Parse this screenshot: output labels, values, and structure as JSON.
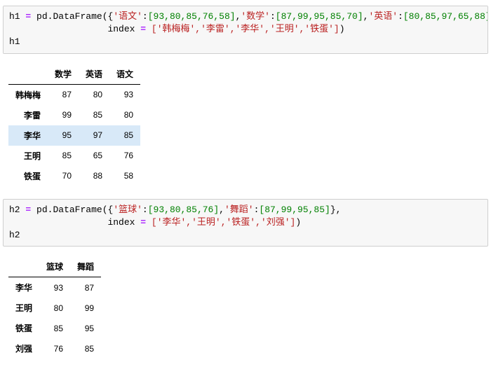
{
  "cell1": {
    "var": "h1",
    "parts": {
      "pd": "pd",
      "dot": ".",
      "df": "DataFrame",
      "openP": "(",
      "openB": "{",
      "k1": "'语文'",
      "colon": ":",
      "v1": "[93,80,85,76,58]",
      "comma": ",",
      "k2": "'数学'",
      "v2": "[87,99,95,85,70]",
      "k3": "'英语'",
      "v3": "[80,85,97,65,88]",
      "closeB": "}",
      "indexKw": "index",
      "eq": "=",
      "idx": "['韩梅梅','李雷','李华','王明','铁蛋']",
      "closeP": ")",
      "line3": "h1"
    }
  },
  "table1": {
    "columns": [
      "数学",
      "英语",
      "语文"
    ],
    "rows": [
      {
        "idx": "韩梅梅",
        "c0": "87",
        "c1": "80",
        "c2": "93"
      },
      {
        "idx": "李雷",
        "c0": "99",
        "c1": "85",
        "c2": "80"
      },
      {
        "idx": "李华",
        "c0": "95",
        "c1": "97",
        "c2": "85",
        "hl": true
      },
      {
        "idx": "王明",
        "c0": "85",
        "c1": "65",
        "c2": "76"
      },
      {
        "idx": "铁蛋",
        "c0": "70",
        "c1": "88",
        "c2": "58"
      }
    ]
  },
  "cell2": {
    "var": "h2",
    "parts": {
      "pd": "pd",
      "dot": ".",
      "df": "DataFrame",
      "openP": "(",
      "openB": "{",
      "k1": "'篮球'",
      "v1": "[93,80,85,76]",
      "comma": ",",
      "k2": "'舞蹈'",
      "v2": "[87,99,95,85]",
      "closeB": "}",
      "indexKw": "index",
      "eq": "=",
      "idx": "['李华','王明','铁蛋','刘强']",
      "closeP": ")",
      "line3": "h2"
    }
  },
  "table2": {
    "columns": [
      "篮球",
      "舞蹈"
    ],
    "rows": [
      {
        "idx": "李华",
        "c0": "93",
        "c1": "87"
      },
      {
        "idx": "王明",
        "c0": "80",
        "c1": "99"
      },
      {
        "idx": "铁蛋",
        "c0": "85",
        "c1": "95"
      },
      {
        "idx": "刘强",
        "c0": "76",
        "c1": "85"
      }
    ]
  }
}
